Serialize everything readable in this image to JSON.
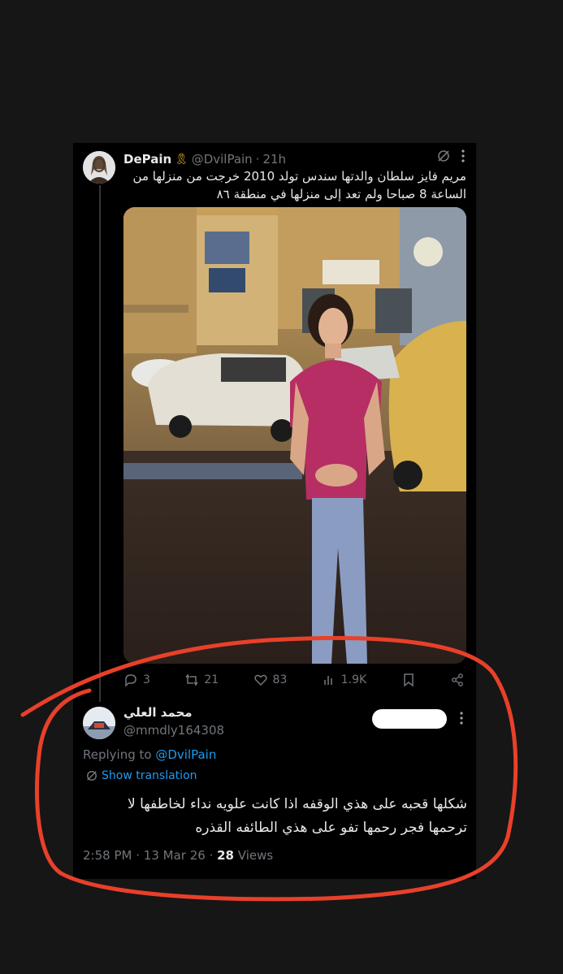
{
  "tweet": {
    "display_name": "DePain",
    "ribbon_icon": "yellow-ribbon-icon",
    "handle": "@DvilPain",
    "separator": "·",
    "time": "21h",
    "text": "مريم فايز سلطان والدتها سندس تولد 2010 خرجت من منزلها من الساعة 8 صباحا ولم تعد إلى منزلها في منطقة ٨٦",
    "stats": {
      "replies": "3",
      "retweets": "21",
      "likes": "83",
      "views": "1.9K"
    }
  },
  "reply": {
    "display_name": "محمد العلي",
    "handle": "@mmdly164308",
    "replying_prefix": "Replying to",
    "replying_to": "@DvilPain",
    "show_translation": "Show translation",
    "text": "شكلها قحبه على هذي الوقفه اذا كانت علويه نداء لخاطفها لا ترحمها فجر رحمها تفو على هذي الطائفه القذره",
    "time": "2:58 PM",
    "date": "13 Mar 26",
    "views_count": "28",
    "views_label": "Views"
  },
  "colors": {
    "page_bg": "#161616",
    "card_bg": "#000000",
    "text": "#e7e9ea",
    "muted": "#71767b",
    "link": "#1d9bf0",
    "annotation": "#e8402a"
  }
}
